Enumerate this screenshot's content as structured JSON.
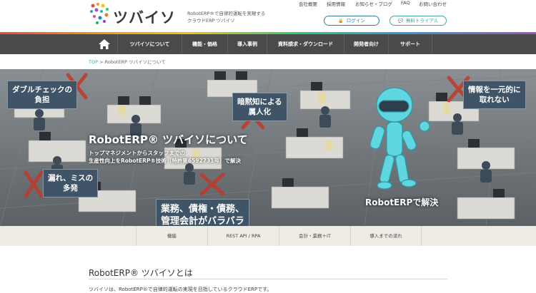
{
  "header": {
    "logo_text": "ツバイソ",
    "tagline_lines": [
      "RobotERP®で自律的運転を実現する",
      "クラウドERP ツバイソ"
    ],
    "toplinks": [
      "会社概要",
      "採用情報",
      "お知らせ・ブログ",
      "FAQ",
      "お問い合わせ"
    ],
    "login_label": "ログイン",
    "trial_label": "無料トライアル"
  },
  "nav": {
    "items": [
      "ツバイソについて",
      "機能・価格",
      "導入事例",
      "資料請求・ダウンロード",
      "開発者向け",
      "サポート"
    ]
  },
  "breadcrumb": {
    "home": "TOP",
    "separator": ">",
    "current": "RobotERP ツバイソについて"
  },
  "hero": {
    "title": "RobotERP® ツバイソについて",
    "subtitle_lines": [
      "トップマネジメントからスタッフまでの",
      "生産性向上をRobotERP®技術（特許第6592731号）で解決"
    ],
    "bubbles": {
      "double_check": [
        "ダブルチェックの",
        "負担"
      ],
      "tacit": [
        "暗黙知による",
        "属人化"
      ],
      "info": [
        "情報を一元的に",
        "取れない"
      ],
      "mistakes": [
        "漏れ、ミスの",
        "多発"
      ],
      "work": [
        "業務、債権・債務、",
        "管理会計がバラバラ"
      ]
    },
    "robot_label": "RobotERPで解決"
  },
  "subnav": {
    "items": [
      "機能",
      "REST API / RPA",
      "会計・業務＋IT",
      "導入までの流れ"
    ]
  },
  "content": {
    "heading": "RobotERP® ツバイソとは",
    "lead": "ツバイソは、RobotERP®で自律的運転の実現を目指しているクラウドERPです。"
  },
  "colors": {
    "nav_bg": "#4a4a4a",
    "accent_teal": "#43a3a8",
    "robot": "#5fd6e0",
    "bubble_bg": "#3f5567",
    "cross": "#c0392b"
  }
}
